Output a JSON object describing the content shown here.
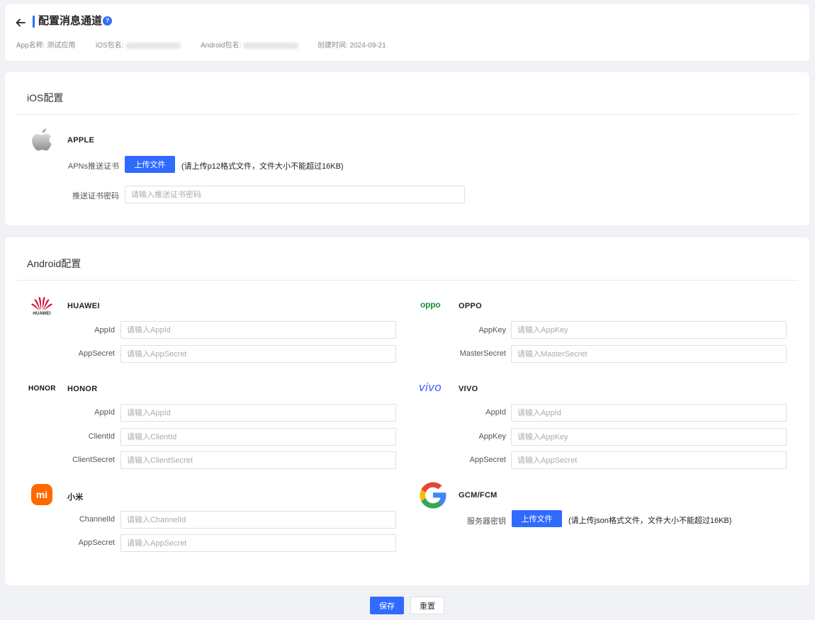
{
  "header": {
    "title": "配置消息通道",
    "help_icon": "?",
    "app_name_label": "App名称:",
    "app_name_value": "测试应用",
    "ios_pkg_label": "iOS包名:",
    "android_pkg_label": "Android包名:",
    "created_label": "创建时间:",
    "created_value": "2024-09-21"
  },
  "ios": {
    "section_title": "iOS配置",
    "apple": {
      "name": "APPLE",
      "cert_label": "APNs推送证书",
      "upload_label": "上传文件",
      "upload_hint": "(请上传p12格式文件，文件大小不能超过16KB)",
      "password_label": "推送证书密码",
      "password_placeholder": "请输入推送证书密码"
    }
  },
  "android": {
    "section_title": "Android配置",
    "huawei": {
      "name": "HUAWEI",
      "logo_text": "HUAWEI",
      "appid_label": "AppId",
      "appid_placeholder": "请输入AppId",
      "appsecret_label": "AppSecret",
      "appsecret_placeholder": "请输入AppSecret"
    },
    "oppo": {
      "name": "OPPO",
      "logo_text": "oppo",
      "appkey_label": "AppKey",
      "appkey_placeholder": "请输入AppKey",
      "mastersecret_label": "MasterSecret",
      "mastersecret_placeholder": "请输入MasterSecret"
    },
    "honor": {
      "name": "HONOR",
      "logo_text": "HONOR",
      "appid_label": "AppId",
      "appid_placeholder": "请输入AppId",
      "clientid_label": "ClientId",
      "clientid_placeholder": "请输入ClientId",
      "clientsecret_label": "ClientSecret",
      "clientsecret_placeholder": "请输入ClientSecret"
    },
    "vivo": {
      "name": "VIVO",
      "logo_text": "vivo",
      "appid_label": "AppId",
      "appid_placeholder": "请输入AppId",
      "appkey_label": "AppKey",
      "appkey_placeholder": "请输入AppKey",
      "appsecret_label": "AppSecret",
      "appsecret_placeholder": "请输入AppSecret"
    },
    "xiaomi": {
      "name": "小米",
      "logo_text": "mi",
      "channelid_label": "ChannelId",
      "channelid_placeholder": "请输入ChannelId",
      "appsecret_label": "AppSecret",
      "appsecret_placeholder": "请输入AppSecret"
    },
    "gcm": {
      "name": "GCM/FCM",
      "key_label": "服务器密钥",
      "upload_label": "上传文件",
      "upload_hint": "(请上传json格式文件，文件大小不能超过16KB)"
    }
  },
  "footer": {
    "save_label": "保存",
    "reset_label": "重置"
  },
  "colors": {
    "primary": "#2f6bff",
    "huawei": "#cf0a2c",
    "oppo": "#1a8f3a",
    "vivo": "#415fff",
    "xiaomi": "#ff6900"
  }
}
